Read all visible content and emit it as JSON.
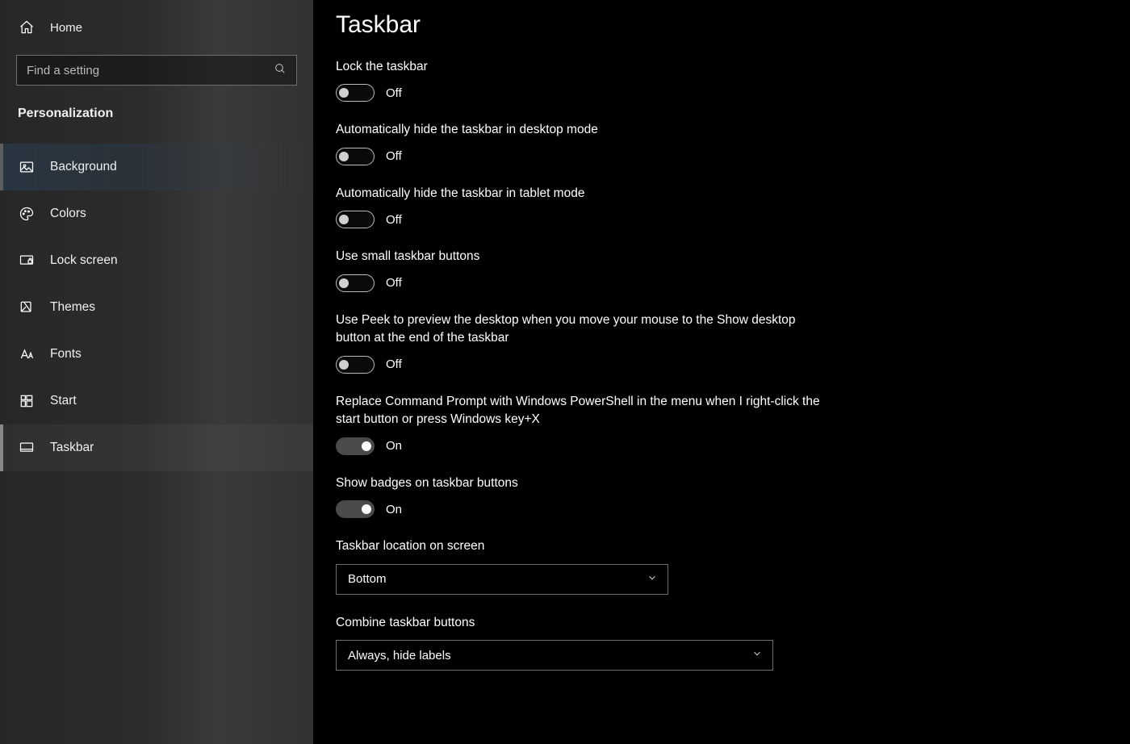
{
  "sidebar": {
    "home": "Home",
    "search_placeholder": "Find a setting",
    "section": "Personalization",
    "items": [
      {
        "key": "background",
        "label": "Background"
      },
      {
        "key": "colors",
        "label": "Colors"
      },
      {
        "key": "lockscreen",
        "label": "Lock screen"
      },
      {
        "key": "themes",
        "label": "Themes"
      },
      {
        "key": "fonts",
        "label": "Fonts"
      },
      {
        "key": "start",
        "label": "Start"
      },
      {
        "key": "taskbar",
        "label": "Taskbar"
      }
    ]
  },
  "page": {
    "title": "Taskbar",
    "toggle_labels": {
      "on": "On",
      "off": "Off"
    },
    "settings": [
      {
        "key": "lock",
        "desc": "Lock the taskbar",
        "on": false
      },
      {
        "key": "autohide_desktop",
        "desc": "Automatically hide the taskbar in desktop mode",
        "on": false
      },
      {
        "key": "autohide_tablet",
        "desc": "Automatically hide the taskbar in tablet mode",
        "on": false
      },
      {
        "key": "small_buttons",
        "desc": "Use small taskbar buttons",
        "on": false
      },
      {
        "key": "peek",
        "desc": "Use Peek to preview the desktop when you move your mouse to the Show desktop button at the end of the taskbar",
        "on": false
      },
      {
        "key": "powershell",
        "desc": "Replace Command Prompt with Windows PowerShell in the menu when I right-click the start button or press Windows key+X",
        "on": true
      },
      {
        "key": "badges",
        "desc": "Show badges on taskbar buttons",
        "on": true
      }
    ],
    "dropdowns": [
      {
        "key": "location",
        "desc": "Taskbar location on screen",
        "value": "Bottom",
        "width": "narrow"
      },
      {
        "key": "combine",
        "desc": "Combine taskbar buttons",
        "value": "Always, hide labels",
        "width": "wide"
      }
    ]
  }
}
